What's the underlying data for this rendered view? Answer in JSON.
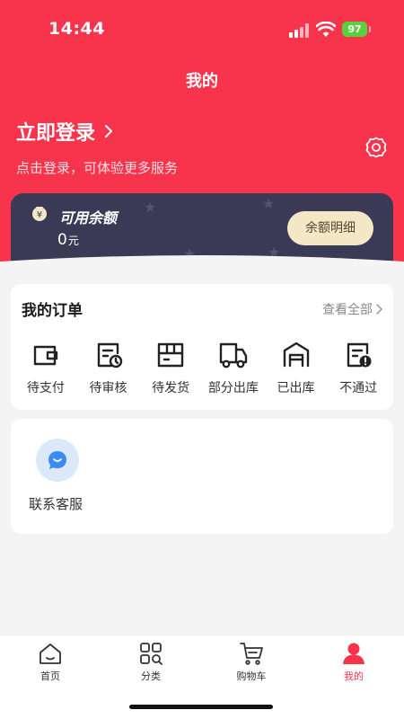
{
  "status_bar": {
    "time": "14:44",
    "battery": "97"
  },
  "header": {
    "title": "我的",
    "login_title": "立即登录",
    "login_subtitle": "点击登录，可体验更多服务"
  },
  "balance": {
    "label": "可用余额",
    "amount": "0",
    "unit": "元",
    "detail_button": "余额明细"
  },
  "orders": {
    "title": "我的订单",
    "view_all": "查看全部",
    "items": [
      {
        "label": "待支付",
        "icon": "wallet-icon"
      },
      {
        "label": "待审核",
        "icon": "document-clock-icon"
      },
      {
        "label": "待发货",
        "icon": "package-icon"
      },
      {
        "label": "部分出库",
        "icon": "truck-icon"
      },
      {
        "label": "已出库",
        "icon": "warehouse-icon"
      },
      {
        "label": "不通过",
        "icon": "document-alert-icon"
      }
    ]
  },
  "service": {
    "label": "联系客服",
    "icon": "chat-bubble-icon"
  },
  "tabbar": {
    "items": [
      {
        "label": "首页",
        "icon": "home-icon"
      },
      {
        "label": "分类",
        "icon": "category-icon"
      },
      {
        "label": "购物车",
        "icon": "cart-icon"
      },
      {
        "label": "我的",
        "icon": "user-icon",
        "active": true
      }
    ]
  },
  "colors": {
    "accent": "#f7344b",
    "card_dark": "#3b3a56",
    "button_gold": "#f3e7c6"
  }
}
